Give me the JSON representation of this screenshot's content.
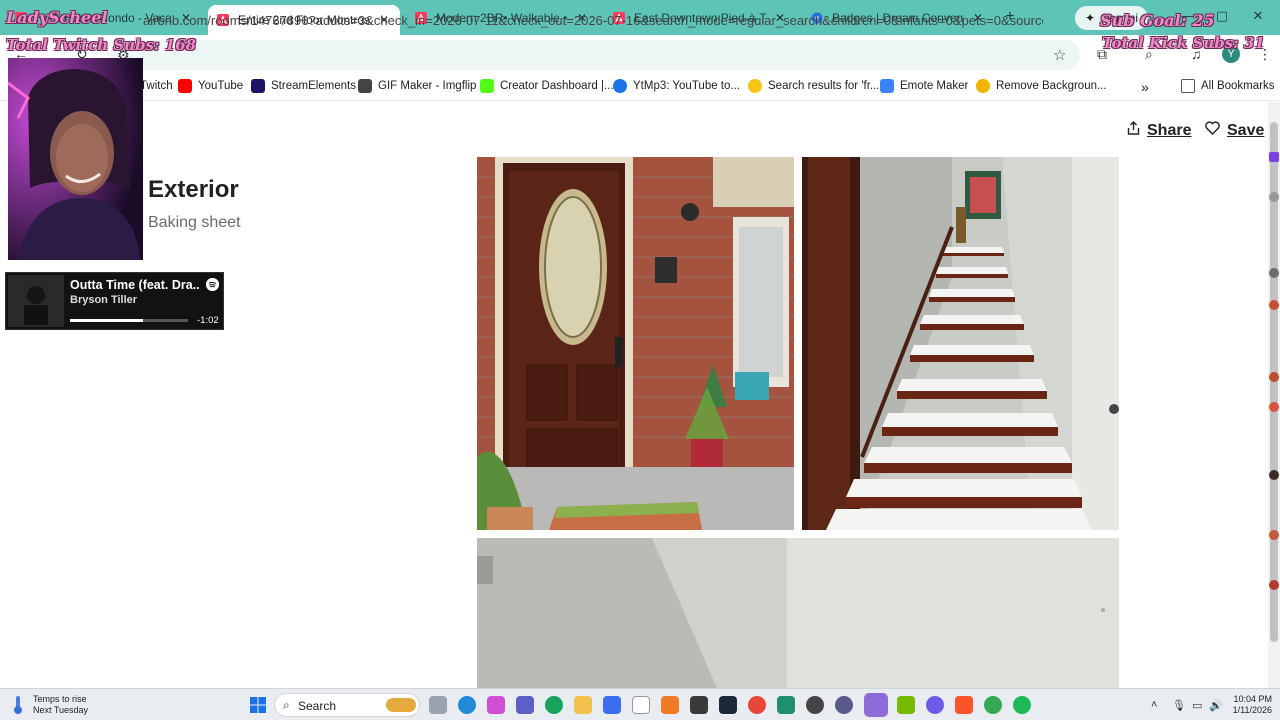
{
  "browser": {
    "tabs": [
      {
        "label": "Hy 5 Home Condo - Vacation R",
        "active": false
      },
      {
        "label": "Entire 2nd Floor Montrose M",
        "active": true
      },
      {
        "label": "Modern 2BR• Walkable • King",
        "active": false
      },
      {
        "label": "East Downtown Pied-à-Terre",
        "active": false
      },
      {
        "label": "Badges | Dream Convention",
        "active": false
      }
    ],
    "tab_close": "✕",
    "new_tab": "+",
    "gemini_label": "Gemini",
    "url": "airbnb.com/rooms/14767896?adults=3&check_in=2026-07-11&check_out=2026-07-16&search_mode=regular_search&children=0&infants=0&pets=0&source_impres...",
    "profile_initial": "Y",
    "bookmarks": [
      {
        "label": "Twitch",
        "icon": "twitch-icon",
        "color": "#9146ff"
      },
      {
        "label": "YouTube",
        "icon": "youtube-icon",
        "color": "#ff0000"
      },
      {
        "label": "StreamElements",
        "icon": "streamelements-icon",
        "color": "#1b1464"
      },
      {
        "label": "GIF Maker - Imgflip",
        "icon": "imgflip-icon",
        "color": "#444444"
      },
      {
        "label": "Creator Dashboard |...",
        "icon": "creator-dashboard-icon",
        "color": "#53fc18"
      },
      {
        "label": "YtMp3: YouTube to...",
        "icon": "ytmp3-icon",
        "color": "#1a73e8"
      },
      {
        "label": "Search results for 'fr...",
        "icon": "search-results-icon",
        "color": "#f5c518"
      },
      {
        "label": "Emote Maker",
        "icon": "emote-maker-icon",
        "color": "#3b82f6"
      },
      {
        "label": "Remove Backgroun...",
        "icon": "remove-bg-icon",
        "color": "#f0b400"
      }
    ],
    "bookmarks_more": "»",
    "all_bookmarks": "All Bookmarks"
  },
  "page": {
    "share_label": "Share",
    "save_label": "Save",
    "section_title": "Exterior",
    "section_subtitle": "Baking sheet"
  },
  "overlays": {
    "top_left_name": "LadyScheel",
    "twitch_subs": "Total Twitch Subs: 168",
    "sub_goal": "Sub Goal: 25",
    "kick_subs": "Total Kick Subs: 31"
  },
  "now_playing": {
    "title": "Outta Time (feat. Dra...",
    "artist": "Bryson Tiller",
    "remaining": "-1:02",
    "progress": 0.62
  },
  "taskbar": {
    "weather_title": "Temps to rise",
    "weather_sub": "Next Tuesday",
    "search_label": "Search",
    "time": "10:04 PM",
    "date": "1/11/2026"
  }
}
